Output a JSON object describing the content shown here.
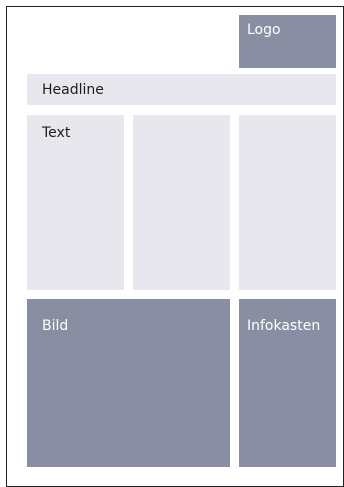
{
  "colors": {
    "light_block": "#e8e7ee",
    "dark_block": "#8a8ea3",
    "frame": "#222222",
    "text_dark": "#1d1d1d",
    "text_light": "#ffffff"
  },
  "blocks": {
    "logo": "Logo",
    "headline": "Headline",
    "text": "Text",
    "bild": "Bild",
    "infokasten": "Infokasten"
  }
}
